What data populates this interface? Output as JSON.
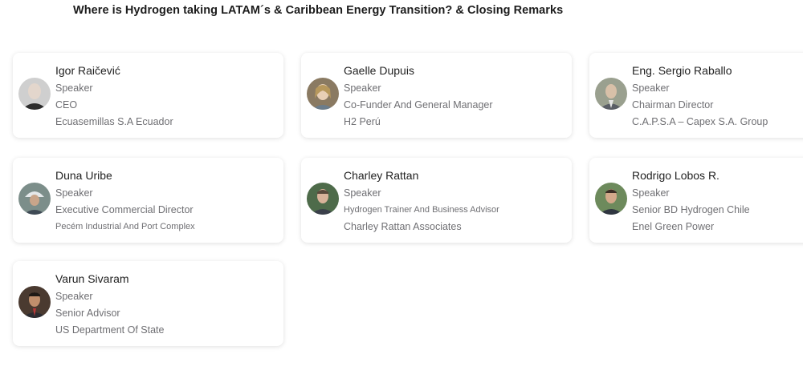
{
  "header": {
    "title": "Where is Hydrogen taking LATAM´s & Caribbean Energy Transition? & Closing Remarks"
  },
  "speakers": [
    {
      "name": "Igor Raičević",
      "role": "Speaker",
      "title": "CEO",
      "org": "Ecuasemillas S.A Ecuador"
    },
    {
      "name": "Gaelle Dupuis",
      "role": "Speaker",
      "title": "Co-Funder And General Manager",
      "org": "H2 Perú"
    },
    {
      "name": "Eng. Sergio Raballo",
      "role": "Speaker",
      "title": "Chairman Director",
      "org": "C.A.P.S.A – Capex S.A. Group"
    },
    {
      "name": "Duna Uribe",
      "role": "Speaker",
      "title": "Executive Commercial Director",
      "org": "Pecém Industrial And Port Complex"
    },
    {
      "name": "Charley Rattan",
      "role": "Speaker",
      "title": "Hydrogen Trainer And Business Advisor",
      "org": "Charley Rattan Associates"
    },
    {
      "name": "Rodrigo Lobos R.",
      "role": "Speaker",
      "title": "Senior BD Hydrogen Chile",
      "org": "Enel Green Power"
    },
    {
      "name": "Varun Sivaram",
      "role": "Speaker",
      "title": "Senior Advisor",
      "org": "US Department Of State"
    }
  ]
}
